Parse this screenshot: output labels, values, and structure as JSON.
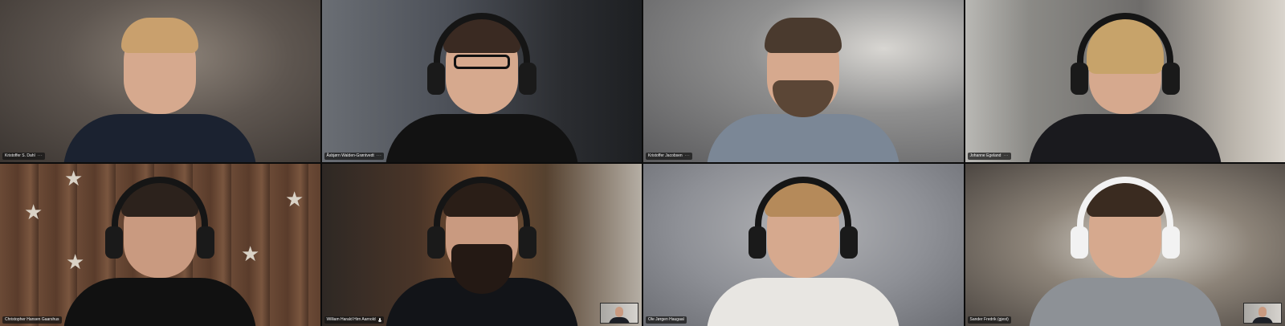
{
  "meeting": {
    "tiles": [
      {
        "id": "t1",
        "name": "Kristoffer S. Dahl",
        "more": "···",
        "muted": false,
        "self_view": false
      },
      {
        "id": "t2",
        "name": "Åsbjørn Walden-Grøntvedt",
        "more": "···",
        "muted": false,
        "self_view": false
      },
      {
        "id": "t3",
        "name": "Kristoffer Jacobsen",
        "more": "···",
        "muted": false,
        "self_view": false
      },
      {
        "id": "t4",
        "name": "Johanne Egeland",
        "more": "···",
        "muted": false,
        "self_view": false
      },
      {
        "id": "t5",
        "name": "Christopher Hansen Gaarshus",
        "more": "",
        "muted": false,
        "self_view": false
      },
      {
        "id": "t6",
        "name": "William Harald Hirn Aarnold",
        "more": "",
        "muted": true,
        "self_view": true
      },
      {
        "id": "t7",
        "name": "Ole Jørgen Haugaal",
        "more": "",
        "muted": false,
        "self_view": false
      },
      {
        "id": "t8",
        "name": "Sander Fredrik (gjest)",
        "more": "",
        "muted": false,
        "self_view": true
      }
    ],
    "icons": {
      "more": "more-options-icon",
      "mic": "microphone-icon",
      "self_view": "self-view-thumbnail"
    }
  }
}
